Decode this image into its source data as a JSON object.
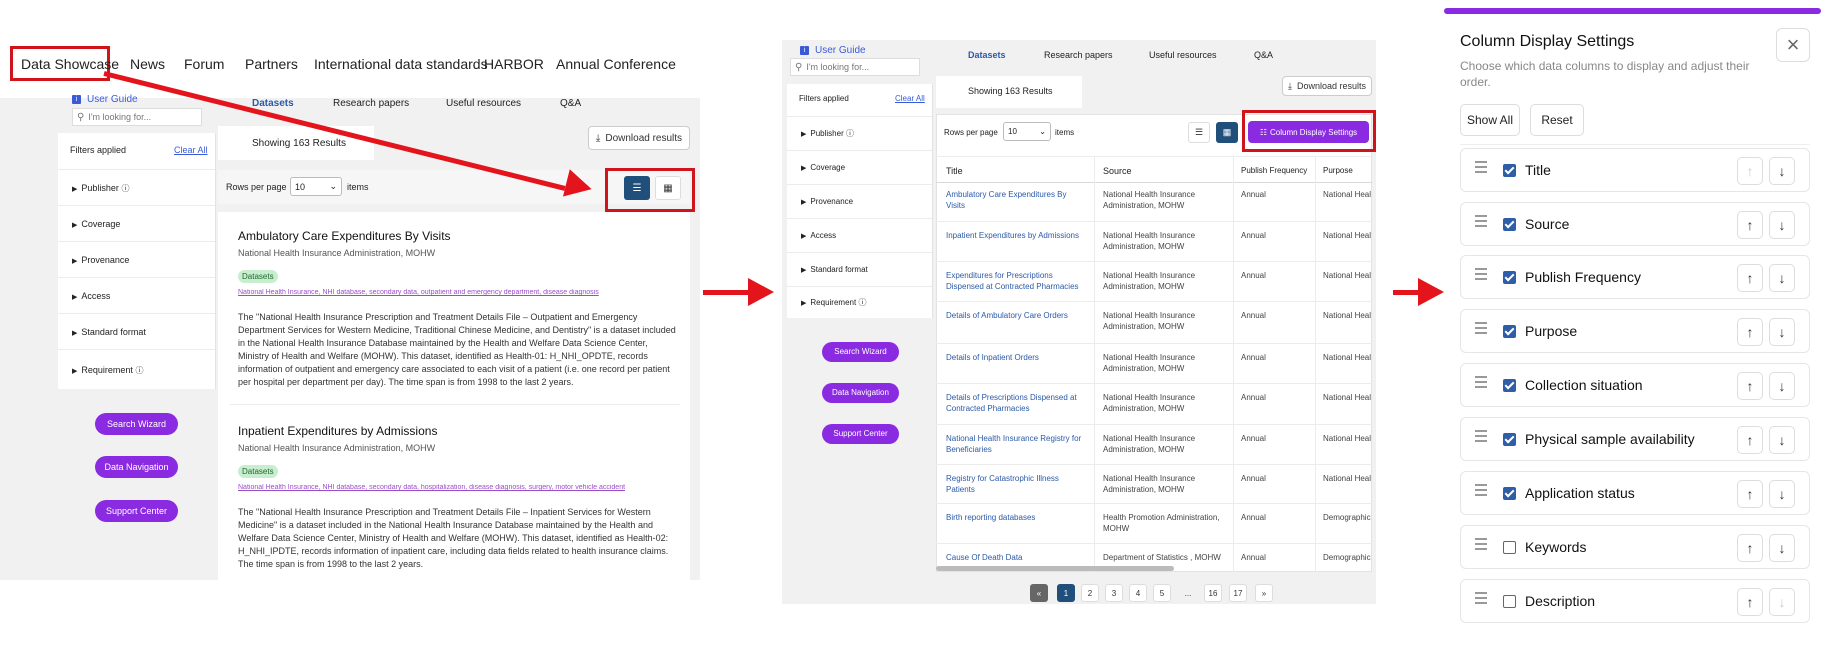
{
  "panel1": {
    "nav": [
      "Data Showcase",
      "News",
      "Forum",
      "Partners",
      "International data standards",
      "HARBOR",
      "Annual Conference"
    ],
    "user_guide": "User Guide",
    "search_placeholder": "I'm looking for...",
    "tabs": [
      "Datasets",
      "Research papers",
      "Useful resources",
      "Q&A"
    ],
    "filters_applied": "Filters applied",
    "clear_all": "Clear All",
    "filters": [
      "Publisher",
      "Coverage",
      "Provenance",
      "Access",
      "Standard format",
      "Requirement"
    ],
    "buttons": [
      "Search Wizard",
      "Data Navigation",
      "Support Center"
    ],
    "showing": "Showing 163 Results",
    "download": "Download results",
    "rows_per_page": "Rows per page",
    "rows_value": "10",
    "items": "items",
    "cards": [
      {
        "title": "Ambulatory Care Expenditures By Visits",
        "publisher": "National Health Insurance Administration, MOHW",
        "badge": "Datasets",
        "keywords": "National Health Insurance, NHI database, secondary data, outpatient and emergency department, disease diagnosis",
        "desc": "The \"National Health Insurance Prescription and Treatment Details File – Outpatient and Emergency Department Services for Western Medicine, Traditional Chinese Medicine, and Dentistry\" is a dataset included in the National Health Insurance Database maintained by the Health and Welfare Data Science Center, Ministry of Health and Welfare (MOHW). This dataset, identified as Health-01: H_NHI_OPDTE, records information of outpatient and emergency care associated to each visit of a patient (i.e. one record per patient per hospital per department per day). The time span is from 1998 to the last 2 years."
      },
      {
        "title": "Inpatient Expenditures by Admissions",
        "publisher": "National Health Insurance Administration, MOHW",
        "badge": "Datasets",
        "keywords": "National Health Insurance, NHI database, secondary data, hospitalization, disease diagnosis, surgery, motor vehicle accident",
        "desc": "The \"National Health Insurance Prescription and Treatment Details File – Inpatient Services for Western Medicine\" is a dataset included in the National Health Insurance Database maintained by the Health and Welfare Data Science Center, Ministry of Health and Welfare (MOHW). This dataset, identified as Health-02: H_NHI_IPDTE, records information of inpatient care, including data fields related to health insurance claims. The time span is from 1998 to the last 2 years."
      }
    ]
  },
  "panel2": {
    "user_guide": "User Guide",
    "search_placeholder": "I'm looking for...",
    "tabs": [
      "Datasets",
      "Research papers",
      "Useful resources",
      "Q&A"
    ],
    "showing": "Showing 163 Results",
    "download": "Download results",
    "filters_applied": "Filters applied",
    "clear_all": "Clear All",
    "filters": [
      "Publisher",
      "Coverage",
      "Provenance",
      "Access",
      "Standard format",
      "Requirement"
    ],
    "buttons": [
      "Search Wizard",
      "Data Navigation",
      "Support Center"
    ],
    "rows_per_page": "Rows per page",
    "rows_value": "10",
    "items": "items",
    "col_settings": "Column Display Settings",
    "headers": [
      "Title",
      "Source",
      "Publish Frequency",
      "Purpose"
    ],
    "rows": [
      [
        "Ambulatory Care Expenditures By Visits",
        "National Health Insurance Administration, MOHW",
        "Annual",
        "National Healt"
      ],
      [
        "Inpatient Expenditures by Admissions",
        "National Health Insurance Administration, MOHW",
        "Annual",
        "National Healt"
      ],
      [
        "Expenditures for Prescriptions Dispensed at Contracted Pharmacies",
        "National Health Insurance Administration, MOHW",
        "Annual",
        "National Healt"
      ],
      [
        "Details of Ambulatory Care Orders",
        "National Health Insurance Administration, MOHW",
        "Annual",
        "National Healt"
      ],
      [
        "Details of Inpatient Orders",
        "National Health Insurance Administration, MOHW",
        "Annual",
        "National Healt"
      ],
      [
        "Details of Prescriptions Dispensed at Contracted Pharmacies",
        "National Health Insurance Administration, MOHW",
        "Annual",
        "National Healt"
      ],
      [
        "National Health Insurance Registry for Beneficiaries",
        "National Health Insurance Administration, MOHW",
        "Annual",
        "National Healt"
      ],
      [
        "Registry for Catastrophic Illness Patients",
        "National Health Insurance Administration, MOHW",
        "Annual",
        "National Healt"
      ],
      [
        "Birth reporting databases",
        "Health Promotion Administration, MOHW",
        "Annual",
        "Demographics"
      ],
      [
        "Cause Of Death Data",
        "Department of Statistics , MOHW",
        "Annual",
        "Demographics"
      ]
    ],
    "pagination": [
      "«",
      "1",
      "2",
      "3",
      "4",
      "5",
      "...",
      "16",
      "17",
      "»"
    ]
  },
  "panel3": {
    "title": "Column Display Settings",
    "desc": "Choose which data columns to display and adjust their order.",
    "show_all": "Show All",
    "reset": "Reset",
    "close": "×",
    "up": "↑",
    "down": "↓",
    "columns": [
      {
        "label": "Title",
        "checked": true
      },
      {
        "label": "Source",
        "checked": true
      },
      {
        "label": "Publish Frequency",
        "checked": true
      },
      {
        "label": "Purpose",
        "checked": true
      },
      {
        "label": "Collection situation",
        "checked": true
      },
      {
        "label": "Physical sample availability",
        "checked": true
      },
      {
        "label": "Application status",
        "checked": true
      },
      {
        "label": "Keywords",
        "checked": false
      },
      {
        "label": "Description",
        "checked": false
      }
    ]
  },
  "colors": {
    "accent": "#8a2be2",
    "highlight": "#d0141b",
    "primary": "#1f4f7a",
    "link": "#2b5aa8"
  }
}
